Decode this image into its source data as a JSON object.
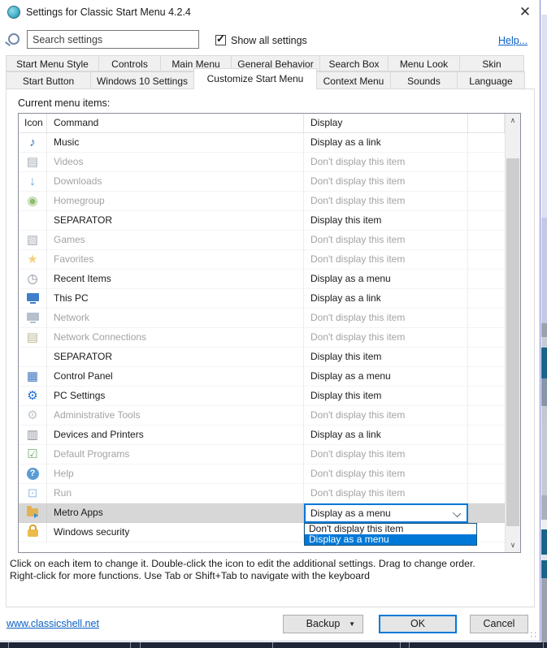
{
  "window": {
    "title": "Settings for Classic Start Menu 4.2.4",
    "close_glyph": "✕"
  },
  "toolbar": {
    "search_placeholder": "Search settings",
    "show_all_label": "Show all settings",
    "show_all_checked": true,
    "check_glyph": "✓",
    "help_link": "Help..."
  },
  "tabs": {
    "row1": [
      "Start Menu Style",
      "Controls",
      "Main Menu",
      "General Behavior",
      "Search Box",
      "Menu Look",
      "Skin"
    ],
    "row2": [
      "Start Button",
      "Windows 10 Settings",
      "Customize Start Menu",
      "Context Menu",
      "Sounds",
      "Language"
    ],
    "active": "Customize Start Menu"
  },
  "content": {
    "list_label": "Current menu items:"
  },
  "table": {
    "headers": [
      "Icon",
      "Command",
      "Display"
    ],
    "rows": [
      {
        "command": "Music",
        "display": "Display as a link",
        "state": "normal",
        "icon": {
          "name": "music-note-icon",
          "glyph": "♪",
          "color": "#2e6fba"
        }
      },
      {
        "command": "Videos",
        "display": "Don't display this item",
        "state": "disabled",
        "icon": {
          "name": "videos-filmstrip-icon",
          "glyph": "▤",
          "color": "#a6acb4"
        }
      },
      {
        "command": "Downloads",
        "display": "Don't display this item",
        "state": "disabled",
        "icon": {
          "name": "downloads-arrow-icon",
          "glyph": "↓",
          "color": "#6fa8dc"
        }
      },
      {
        "command": "Homegroup",
        "display": "Don't display this item",
        "state": "disabled",
        "icon": {
          "name": "homegroup-icon",
          "glyph": "◉",
          "color": "#90bd70"
        }
      },
      {
        "command": "SEPARATOR",
        "display": "Display this item",
        "state": "normal",
        "icon": null
      },
      {
        "command": "Games",
        "display": "Don't display this item",
        "state": "disabled",
        "icon": {
          "name": "games-icon",
          "glyph": "▧",
          "color": "#aab0b8"
        }
      },
      {
        "command": "Favorites",
        "display": "Don't display this item",
        "state": "disabled",
        "icon": {
          "name": "favorites-star-icon",
          "glyph": "★",
          "color": "#f3d085"
        }
      },
      {
        "command": "Recent Items",
        "display": "Display as a menu",
        "state": "normal",
        "icon": {
          "name": "recent-items-clock-icon",
          "glyph": "◷",
          "color": "#868c96"
        }
      },
      {
        "command": "This PC",
        "display": "Display as a link",
        "state": "normal",
        "icon": {
          "name": "this-pc-monitor-icon",
          "shape": "monitor",
          "color": "#3f7ec9"
        }
      },
      {
        "command": "Network",
        "display": "Don't display this item",
        "state": "disabled",
        "icon": {
          "name": "network-icon",
          "shape": "monitor",
          "color": "#b6c0cc"
        }
      },
      {
        "command": "Network Connections",
        "display": "Don't display this item",
        "state": "disabled",
        "icon": {
          "name": "network-connections-icon",
          "glyph": "▤",
          "color": "#b9b896"
        }
      },
      {
        "command": "SEPARATOR",
        "display": "Display this item",
        "state": "normal",
        "icon": null
      },
      {
        "command": "Control Panel",
        "display": "Display as a menu",
        "state": "normal",
        "icon": {
          "name": "control-panel-icon",
          "glyph": "▦",
          "color": "#3a76c4"
        }
      },
      {
        "command": "PC Settings",
        "display": "Display this item",
        "state": "normal",
        "icon": {
          "name": "pc-settings-gear-icon",
          "glyph": "⚙",
          "color": "#1e6fd0"
        }
      },
      {
        "command": "Administrative Tools",
        "display": "Don't display this item",
        "state": "disabled",
        "icon": {
          "name": "administrative-tools-icon",
          "glyph": "⚙",
          "color": "#c0c4ca"
        }
      },
      {
        "command": "Devices and Printers",
        "display": "Display as a link",
        "state": "normal",
        "icon": {
          "name": "devices-printers-icon",
          "glyph": "▥",
          "color": "#8a909a"
        }
      },
      {
        "command": "Default Programs",
        "display": "Don't display this item",
        "state": "disabled",
        "icon": {
          "name": "default-programs-icon",
          "glyph": "☑",
          "color": "#74b06f"
        }
      },
      {
        "command": "Help",
        "display": "Don't display this item",
        "state": "disabled",
        "icon": {
          "name": "help-question-icon",
          "shape": "circle",
          "glyph": "?",
          "color": "#5b9bd5"
        }
      },
      {
        "command": "Run",
        "display": "Don't display this item",
        "state": "disabled",
        "icon": {
          "name": "run-icon",
          "glyph": "⊡",
          "color": "#9cc2e8"
        }
      },
      {
        "command": "Metro Apps",
        "display": "",
        "state": "selected",
        "icon": {
          "name": "metro-apps-folder-icon",
          "shape": "folder",
          "color": "#e2b252"
        }
      },
      {
        "command": "Windows security",
        "display": "",
        "state": "normal",
        "icon": {
          "name": "windows-security-lock-icon",
          "shape": "lock",
          "color": "#edbb4c"
        }
      }
    ]
  },
  "dropdown": {
    "value": "Display as a menu",
    "options": [
      {
        "label": "Don't display this item",
        "selected": false
      },
      {
        "label": "Display as a menu",
        "selected": true
      }
    ]
  },
  "footer": {
    "instructions_line1": "Click on each item to change it. Double-click the icon to edit the additional settings. Drag to change order.",
    "instructions_line2": "Right-click for more functions. Use Tab or Shift+Tab to navigate with the keyboard"
  },
  "bottom": {
    "website_link": "www.classicshell.net",
    "backup_label": "Backup",
    "ok_label": "OK",
    "cancel_label": "Cancel"
  },
  "colors": {
    "accent": "#0078d7",
    "selection_bg": "#0078d7",
    "selected_row_bg": "#d7d7d7",
    "disabled_text": "#a3a3a3",
    "link": "#0a5fc4"
  }
}
